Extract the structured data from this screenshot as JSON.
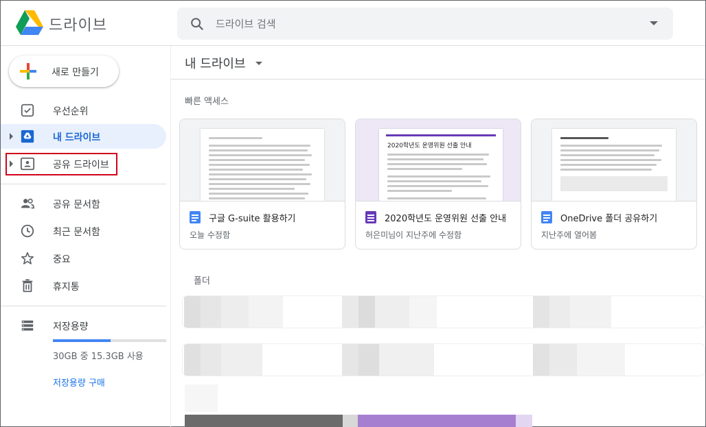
{
  "app": {
    "title": "드라이브"
  },
  "search": {
    "placeholder": "드라이브 검색"
  },
  "sidebar": {
    "new_button": "새로 만들기",
    "items": [
      {
        "label": "우선순위",
        "icon": "priority-icon"
      },
      {
        "label": "내 드라이브",
        "icon": "my-drive-icon",
        "active": true
      },
      {
        "label": "공유 드라이브",
        "icon": "shared-drive-icon",
        "highlighted": true
      },
      {
        "label": "공유 문서함",
        "icon": "shared-with-me-icon"
      },
      {
        "label": "최근 문서함",
        "icon": "recent-icon"
      },
      {
        "label": "중요",
        "icon": "star-icon"
      },
      {
        "label": "휴지통",
        "icon": "trash-icon"
      }
    ],
    "storage": {
      "label": "저장용량",
      "usage": "30GB 중 15.3GB 사용",
      "used_fraction": 0.51,
      "buy": "저장용량 구매"
    }
  },
  "main": {
    "title": "내 드라이브",
    "quick_access_title": "빠른 액세스",
    "quick_access": [
      {
        "name": "구글 G-suite 활용하기",
        "sub": "오늘 수정함",
        "type": "docs"
      },
      {
        "name": "2020학년도 운영위원 선출 안내",
        "sub": "허은미님이 지난주에 수정함",
        "type": "forms",
        "preview_title": "2020학년도 운영위원 선출 안내"
      },
      {
        "name": "OneDrive 폴더 공유하기",
        "sub": "지난주에 열어봄",
        "type": "docs"
      }
    ],
    "folders_title": "폴더"
  },
  "colors": {
    "accent": "#1a73e8",
    "active_bg": "#e8f0fe",
    "docs_blue": "#4285f4",
    "forms_purple": "#673ab7",
    "highlight_red": "#d0021b"
  }
}
